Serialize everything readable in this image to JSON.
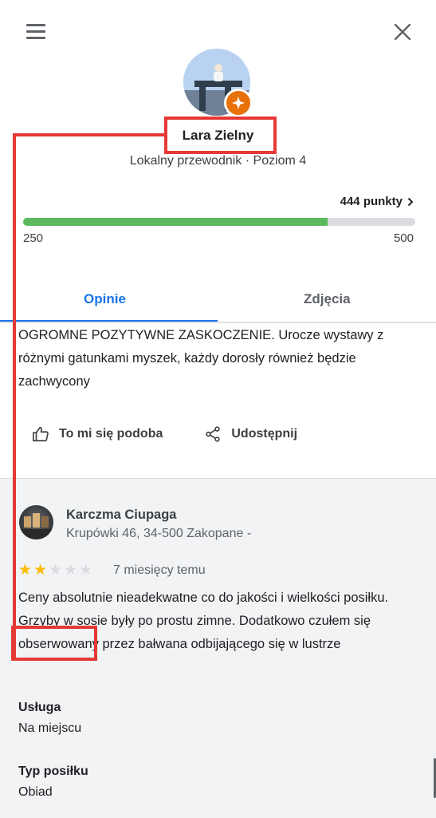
{
  "header": {
    "menu_icon": "hamburger-menu-icon",
    "close_icon": "close-icon"
  },
  "profile": {
    "name": "Lara Zielny",
    "subtitle": "Lokalny przewodnik · Poziom 4",
    "badge_icon": "local-guide-star-icon",
    "points_label": "444 punkty",
    "progress_min": "250",
    "progress_max": "500",
    "progress_fraction": 0.776
  },
  "tabs": [
    {
      "label": "Opinie",
      "active": true
    },
    {
      "label": "Zdjęcia",
      "active": false
    }
  ],
  "review1": {
    "text": "OGROMNE POZYTYWNE ZASKOCZENIE. Urocze wystawy z różnymi gatunkami myszek, każdy dorosły również będzie zachwycony",
    "like_label": "To mi się podoba",
    "share_label": "Udostępnij"
  },
  "review2": {
    "place_name": "Karczma Ciupaga",
    "place_address": "Krupówki 46, 34-500 Zakopane",
    "address_suffix": "-",
    "rating": 2,
    "rating_max": 5,
    "time": "7 miesięcy temu",
    "text_part1": "Ceny absolutnie nieadekwatne co do jakości i wielkości posiłku. Grzyby w sosie były po prostu zimne. Dodatkowo ",
    "text_highlight": "czułem się",
    "text_part2": " obserwowany przez bałwana odbijającego się w lustrze",
    "service_label": "Usługa",
    "service_value": "Na miejscu",
    "meal_label": "Typ posiłku",
    "meal_value": "Obiad"
  },
  "colors": {
    "accent": "#1a73e8",
    "progress": "#5cb85c",
    "badge": "#e8710a",
    "highlight": "#e53935",
    "star_on": "#fbbc04"
  }
}
